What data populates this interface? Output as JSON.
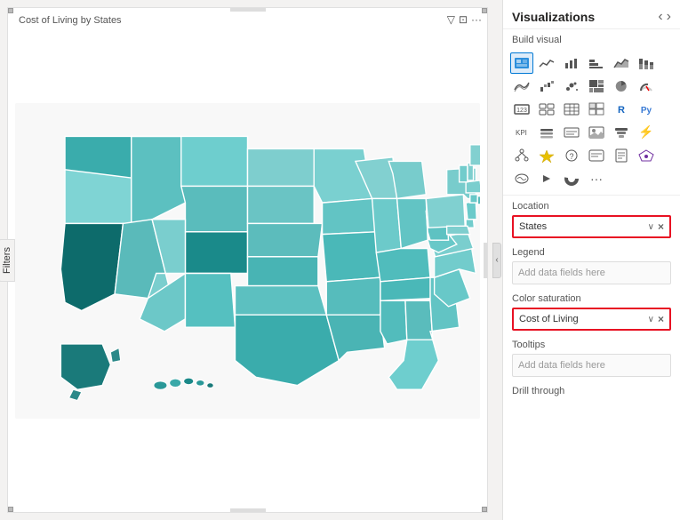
{
  "header": {
    "title": "Visualizations",
    "nav_prev": "‹",
    "nav_next": "›",
    "build_visual_label": "Build visual"
  },
  "map": {
    "title": "Cost of Living by States",
    "toolbar": {
      "filter_icon": "▽",
      "expand_icon": "⊡",
      "more_icon": "···"
    }
  },
  "filters_tab": "Filters",
  "icon_rows": [
    [
      "▦",
      "📊",
      "≡",
      "📉",
      "📈",
      "|||"
    ],
    [
      "~",
      "∧",
      "📈",
      "🔢",
      "📊",
      "📉"
    ],
    [
      "▓",
      "⊞",
      "⊟",
      "◕",
      "◔",
      "▦"
    ],
    [
      "◳",
      "⊠",
      "⊡",
      "✦",
      "R",
      "Py"
    ],
    [
      "◈",
      "⊕",
      "💬",
      "📄",
      "📊",
      "🗺"
    ],
    [
      "◈",
      "▷",
      "◉",
      "···"
    ]
  ],
  "fields": {
    "location_label": "Location",
    "location_value": "States",
    "location_placeholder": "Add data fields here",
    "legend_label": "Legend",
    "legend_placeholder": "Add data fields here",
    "color_saturation_label": "Color saturation",
    "color_saturation_value": "Cost of Living",
    "color_saturation_placeholder": "Add data fields here",
    "tooltips_label": "Tooltips",
    "tooltips_placeholder": "Add data fields here",
    "drill_through_label": "Drill through"
  },
  "colors": {
    "teal_light": "#7ececa",
    "teal_mid": "#40b0b0",
    "teal_dark": "#1a7a7a",
    "teal_darkest": "#0d5555",
    "accent_blue": "#0078d4",
    "red_border": "#e81123"
  }
}
